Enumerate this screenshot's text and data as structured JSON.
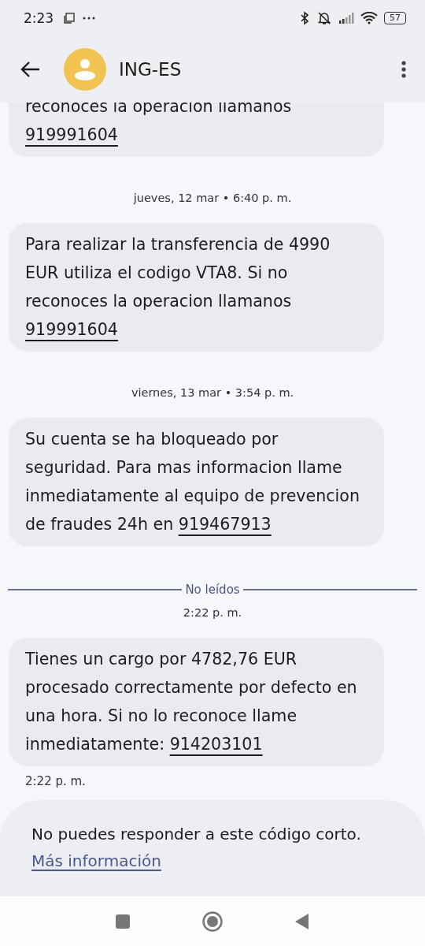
{
  "status_bar": {
    "time": "2:23",
    "battery": "57"
  },
  "header": {
    "title": "ING-ES"
  },
  "messages": [
    {
      "kind": "bubble",
      "text": "reconoces la operacion llamanos",
      "link": "919991604"
    },
    {
      "kind": "date",
      "text": "jueves, 12 mar • 6:40 p. m."
    },
    {
      "kind": "bubble",
      "text": "Para realizar la transferencia de 4990 EUR utiliza el codigo VTA8. Si no reconoces la operacion llamanos",
      "link": "919991604"
    },
    {
      "kind": "date",
      "text": "viernes, 13 mar • 3:54 p. m."
    },
    {
      "kind": "bubble",
      "text": "Su cuenta se ha bloqueado por seguridad. Para mas informacion llame inmediatamente al equipo de prevencion de fraudes 24h en",
      "link": "919467913"
    },
    {
      "kind": "divider",
      "text": "No leídos"
    },
    {
      "kind": "date",
      "text": "2:22 p. m."
    },
    {
      "kind": "bubble",
      "text": "Tienes un cargo por 4782,76 EUR procesado correctamente por defecto en una hora. Si no lo reconoce llame inmediatamente:",
      "link": "914203101"
    },
    {
      "kind": "time",
      "text": "2:22 p. m."
    }
  ],
  "footer": {
    "text": "No puedes responder a este código corto.",
    "link": "Más información"
  }
}
